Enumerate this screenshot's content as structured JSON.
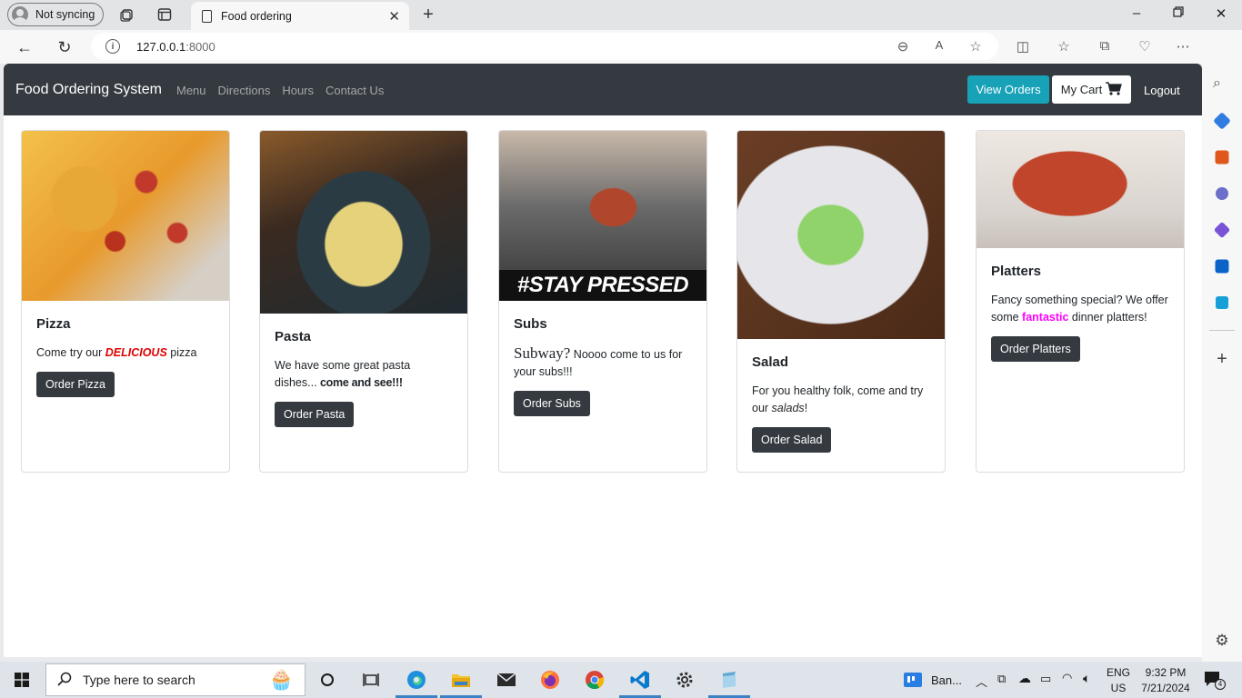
{
  "browser": {
    "profile_label": "Not syncing",
    "tab_title": "Food ordering",
    "url_host": "127.0.0.1",
    "url_port": ":8000"
  },
  "navbar": {
    "brand": "Food Ordering System",
    "links": [
      "Menu",
      "Directions",
      "Hours",
      "Contact Us"
    ],
    "view_orders": "View Orders",
    "my_cart": "My Cart",
    "logout": "Logout",
    "accent_color": "#17a2b8",
    "bg_color": "#343a40"
  },
  "cards": [
    {
      "title": "Pizza",
      "text_before": "Come try our ",
      "emphasis": "DELICIOUS",
      "text_after": " pizza",
      "button": "Order Pizza"
    },
    {
      "title": "Pasta",
      "text_before": "We have some great pasta dishes... ",
      "emphasis": "come and see!!!",
      "text_after": "",
      "button": "Order Pasta"
    },
    {
      "title": "Subs",
      "emphasis": "Subway?",
      "text_after": " Noooo come to us for your subs!!!",
      "button": "Order Subs",
      "image_caption": "#STAY PRESSED"
    },
    {
      "title": "Salad",
      "text_before": "For you healthy folk, come and try our ",
      "emphasis": "salads",
      "text_after": "!",
      "button": "Order Salad"
    },
    {
      "title": "Platters",
      "text_before": "Fancy something special? We offer some ",
      "emphasis": "fantastic",
      "text_after": " dinner platters!",
      "button": "Order Platters"
    }
  ],
  "taskbar": {
    "search_placeholder": "Type here to search",
    "app_label": "Ban...",
    "lang": "ENG",
    "region": "US",
    "time": "9:32 PM",
    "date": "7/21/2024",
    "notifications": "4"
  }
}
